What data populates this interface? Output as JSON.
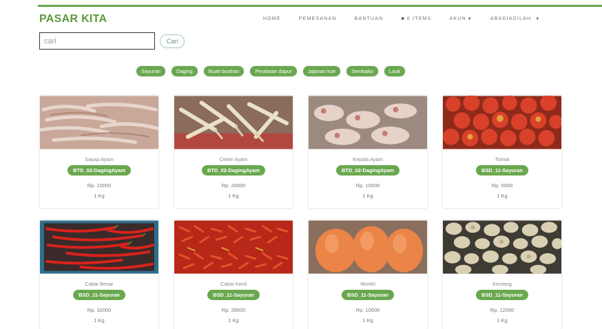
{
  "brand": "PASAR KITA",
  "nav": {
    "home": "HOME",
    "pemesanan": "PEMESANAN",
    "bantuan": "BANTUAN",
    "items": "0 ITEMS",
    "akun": "AKUN",
    "user": "ABADIADILAH"
  },
  "search": {
    "value": "cari",
    "button": "Cari"
  },
  "categories": [
    "Sayuran",
    "Daging",
    "Buah buahan",
    "Peralatan dapur",
    "Jajanan kue",
    "Sembako",
    "Lauk"
  ],
  "products": [
    {
      "name": "Sayap Ayam",
      "code": "BTD_02-DagingAyam",
      "price": "Rp. 10000",
      "unit": "1 Kg",
      "image": "chicken-wings"
    },
    {
      "name": "Ceker Ayam",
      "code": "BTD_02-DagingAyam",
      "price": "Rp. 20000",
      "unit": "1 Kg",
      "image": "chicken-feet"
    },
    {
      "name": "Kepala Ayam",
      "code": "BTD_02-DagingAyam",
      "price": "Rp. 10000",
      "unit": "1 Kg",
      "image": "chicken-heads"
    },
    {
      "name": "Tomat",
      "code": "BSD_11-Sayuran",
      "price": "Rp. 5000",
      "unit": "1 Kg",
      "image": "tomatoes"
    },
    {
      "name": "Cabai Besar",
      "code": "BSD_11-Sayuran",
      "price": "Rp. 32000",
      "unit": "1 Kg",
      "image": "red-chilies"
    },
    {
      "name": "Cabai Kecil",
      "code": "BSD_11-Sayuran",
      "price": "Rp. 28000",
      "unit": "1 Kg",
      "image": "small-chilies"
    },
    {
      "name": "Wortel",
      "code": "BSD_11-Sayuran",
      "price": "Rp. 10000",
      "unit": "1 Kg",
      "image": "carrots"
    },
    {
      "name": "Kentang",
      "code": "BSD_11-Sayuran",
      "price": "Rp. 12000",
      "unit": "1 Kg",
      "image": "potatoes"
    }
  ],
  "colors": {
    "accent": "#6aa84f",
    "brand": "#5b9a3a"
  }
}
